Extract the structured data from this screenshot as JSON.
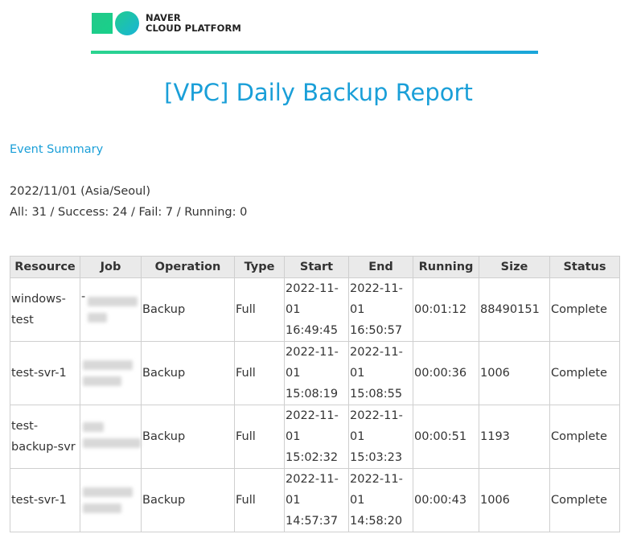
{
  "brand": {
    "line1": "NAVER",
    "line2": "CLOUD PLATFORM"
  },
  "title": "[VPC] Daily Backup Report",
  "event_summary": "Event Summary",
  "date_line": "2022/11/01 (Asia/Seoul)",
  "stats_line": "All: 31 / Success: 24 / Fail: 7 / Running: 0",
  "table": {
    "headers": [
      "Resource",
      "Job",
      "Operation",
      "Type",
      "Start",
      "End",
      "Running",
      "Size",
      "Status"
    ],
    "rows": [
      {
        "resource_l1": "windows-",
        "resource_l2": "test",
        "job_l1": "-",
        "job_l2": "",
        "operation": "Backup",
        "type": "Full",
        "start_l1": "2022-11-",
        "start_l2": "01",
        "start_l3": "16:49:45",
        "end_l1": "2022-11-",
        "end_l2": "01",
        "end_l3": "16:50:57",
        "running": "00:01:12",
        "size": "88490151",
        "status": "Complete"
      },
      {
        "resource_l1": "test-svr-1",
        "resource_l2": "",
        "job_l1": "",
        "job_l2": "",
        "operation": "Backup",
        "type": "Full",
        "start_l1": "2022-11-",
        "start_l2": "01",
        "start_l3": "15:08:19",
        "end_l1": "2022-11-",
        "end_l2": "01",
        "end_l3": "15:08:55",
        "running": "00:00:36",
        "size": "1006",
        "status": "Complete"
      },
      {
        "resource_l1": "test-",
        "resource_l2": "backup-svr",
        "job_l1": "",
        "job_l2": "",
        "operation": "Backup",
        "type": "Full",
        "start_l1": "2022-11-",
        "start_l2": "01",
        "start_l3": "15:02:32",
        "end_l1": "2022-11-",
        "end_l2": "01",
        "end_l3": "15:03:23",
        "running": "00:00:51",
        "size": "1193",
        "status": "Complete"
      },
      {
        "resource_l1": "test-svr-1",
        "resource_l2": "",
        "job_l1": "",
        "job_l2": "",
        "operation": "Backup",
        "type": "Full",
        "start_l1": "2022-11-",
        "start_l2": "01",
        "start_l3": "14:57:37",
        "end_l1": "2022-11-",
        "end_l2": "01",
        "end_l3": "14:58:20",
        "running": "00:00:43",
        "size": "1006",
        "status": "Complete"
      }
    ]
  },
  "colors": {
    "accent": "#1a9fd8",
    "brand_green": "#22c98a",
    "header_bg": "#eaeaea"
  }
}
